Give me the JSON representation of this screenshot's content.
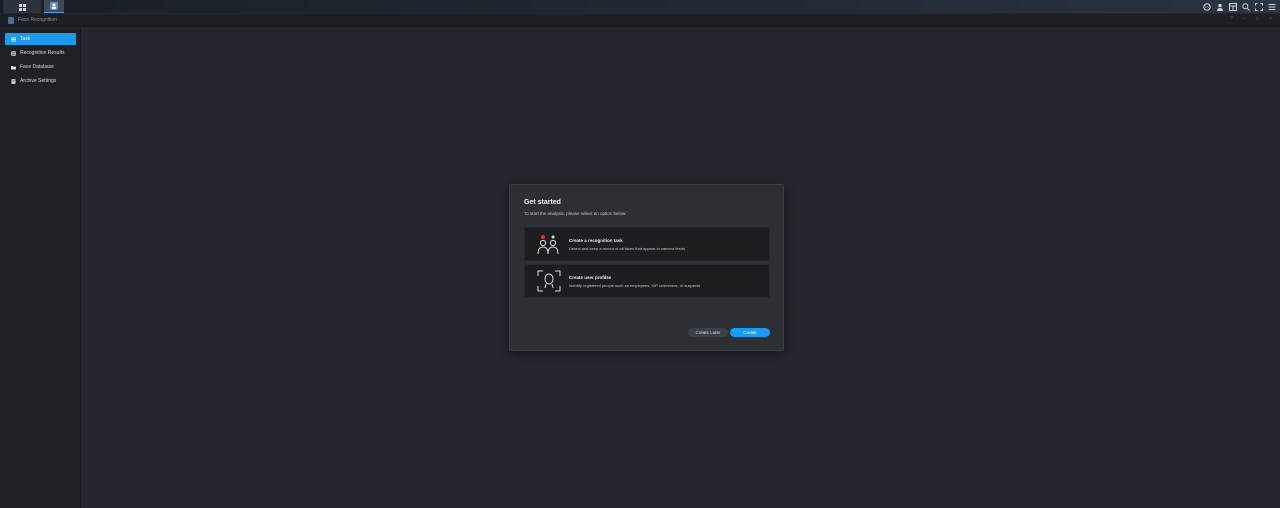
{
  "window": {
    "title": "Face Recognition"
  },
  "taskbar": {
    "launcher_icon": "grid-icon",
    "app_icon": "face-recognition-icon",
    "right_icons": [
      "chat-icon",
      "user-icon",
      "widgets-icon",
      "search-icon",
      "fullscreen-icon",
      "menu-icon"
    ]
  },
  "sidebar": {
    "items": [
      {
        "label": "Task",
        "icon": "list-icon",
        "active": true
      },
      {
        "label": "Recognition Results",
        "icon": "results-icon",
        "active": false
      },
      {
        "label": "Face Database",
        "icon": "folder-icon",
        "active": false
      },
      {
        "label": "Archive Settings",
        "icon": "archive-icon",
        "active": false
      }
    ]
  },
  "dialog": {
    "title": "Get started",
    "subtitle": "To start the analysis, please select an option below:",
    "options": [
      {
        "title": "Create a recognition task",
        "description": "Detect and keep a record of all faces that appear in camera feeds",
        "icon": "people-recording-icon"
      },
      {
        "title": "Create user profiles",
        "description": "Identify registered people such as employees, VIP customers, or suspects",
        "icon": "face-scan-icon"
      }
    ],
    "buttons": {
      "later": "Create Later",
      "create": "Create"
    }
  },
  "colors": {
    "accent": "#1a9bf0",
    "background": "#24272d",
    "dialog": "#2c2f34",
    "record_dot": "#e0343a"
  }
}
